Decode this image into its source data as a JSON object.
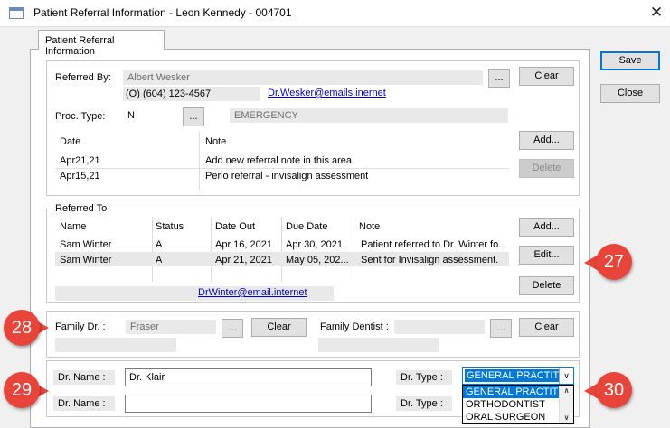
{
  "window": {
    "title": "Patient Referral Information - Leon Kennedy - 004701",
    "close_glyph": "✕"
  },
  "tab": {
    "label": "Patient Referral Information"
  },
  "side_buttons": {
    "save": "Save",
    "close": "Close"
  },
  "referred_by": {
    "label": "Referred By:",
    "name": "Albert Wesker",
    "phone": "(O) (604) 123-4567",
    "email": "Dr.Wesker@emails.inernet",
    "ellipsis": "...",
    "clear": "Clear",
    "proc_type_label": "Proc. Type:",
    "proc_type_value": "N",
    "proc_type_desc": "EMERGENCY",
    "notes_header": {
      "date": "Date",
      "note": "Note"
    },
    "notes": [
      {
        "date": "Apr21,21",
        "note": "Add new referral note in this area"
      },
      {
        "date": "Apr15,21",
        "note": "Perio referral - invisalign assessment"
      }
    ],
    "add": "Add...",
    "delete": "Delete"
  },
  "referred_to": {
    "label": "Referred To",
    "columns": [
      "Name",
      "Status",
      "Date Out",
      "Due Date",
      "Note"
    ],
    "rows": [
      [
        "Sam Winter",
        "A",
        "Apr 16, 2021",
        "Apr 30, 2021",
        "Patient referred to Dr. Winter fo..."
      ],
      [
        "Sam Winter",
        "A",
        "Apr 21, 2021",
        "May 05, 202...",
        "Sent for Invisalign assessment."
      ]
    ],
    "email": "DrWinter@email.internet",
    "add": "Add...",
    "edit": "Edit...",
    "delete": "Delete"
  },
  "family": {
    "dr_label": "Family Dr. :",
    "dr_value": "Fraser",
    "ellipsis": "...",
    "clear": "Clear",
    "dentist_label": "Family Dentist :",
    "dentist_value": "",
    "dentist_clear": "Clear"
  },
  "doctors": {
    "name_label": "Dr. Name :",
    "type_label": "Dr. Type :",
    "name1": "Dr. Klair",
    "name2": "",
    "type_selected": "GENERAL PRACTIT",
    "type_options": [
      "GENERAL PRACTIT",
      "ORTHODONTIST",
      "ORAL SURGEON"
    ]
  },
  "callouts": [
    "27",
    "28",
    "29",
    "30"
  ],
  "colors": {
    "callout": "#e8443a",
    "selection": "#0078d7",
    "link": "#0000cc"
  }
}
